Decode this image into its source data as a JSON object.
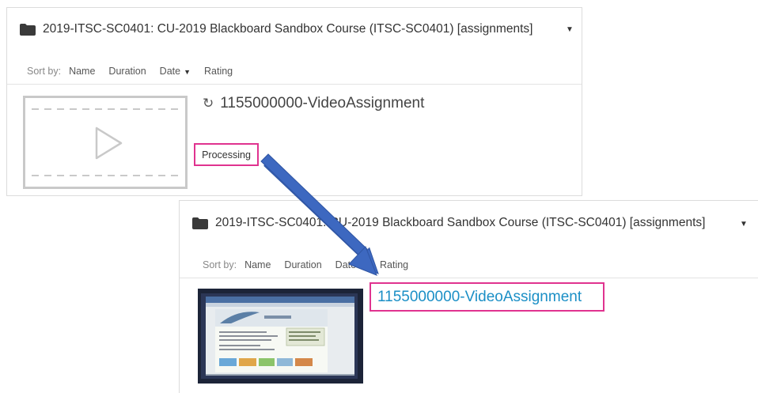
{
  "top_panel": {
    "category_title": "2019-ITSC-SC0401: CU-2019 Blackboard Sandbox Course (ITSC-SC0401) [assignments]",
    "sort": {
      "label": "Sort by:",
      "options": [
        "Name",
        "Duration",
        "Date",
        "Rating"
      ],
      "active": "Date"
    },
    "entry": {
      "title": "1155000000-VideoAssignment",
      "status": "Processing"
    }
  },
  "bottom_panel": {
    "category_title": "2019-ITSC-SC0401: CU-2019 Blackboard Sandbox Course (ITSC-SC0401) [assignments]",
    "sort": {
      "label": "Sort by:",
      "options": [
        "Name",
        "Duration",
        "Date",
        "Rating"
      ],
      "active": "Date"
    },
    "entry": {
      "title": "1155000000-VideoAssignment"
    }
  },
  "icons": {
    "folder": "folder-icon",
    "caret": "caret-down-icon",
    "refresh": "refresh-icon",
    "play": "play-icon"
  },
  "colors": {
    "highlight": "#e0338f",
    "link": "#1b8fc6",
    "arrow": "#3d68c0"
  }
}
